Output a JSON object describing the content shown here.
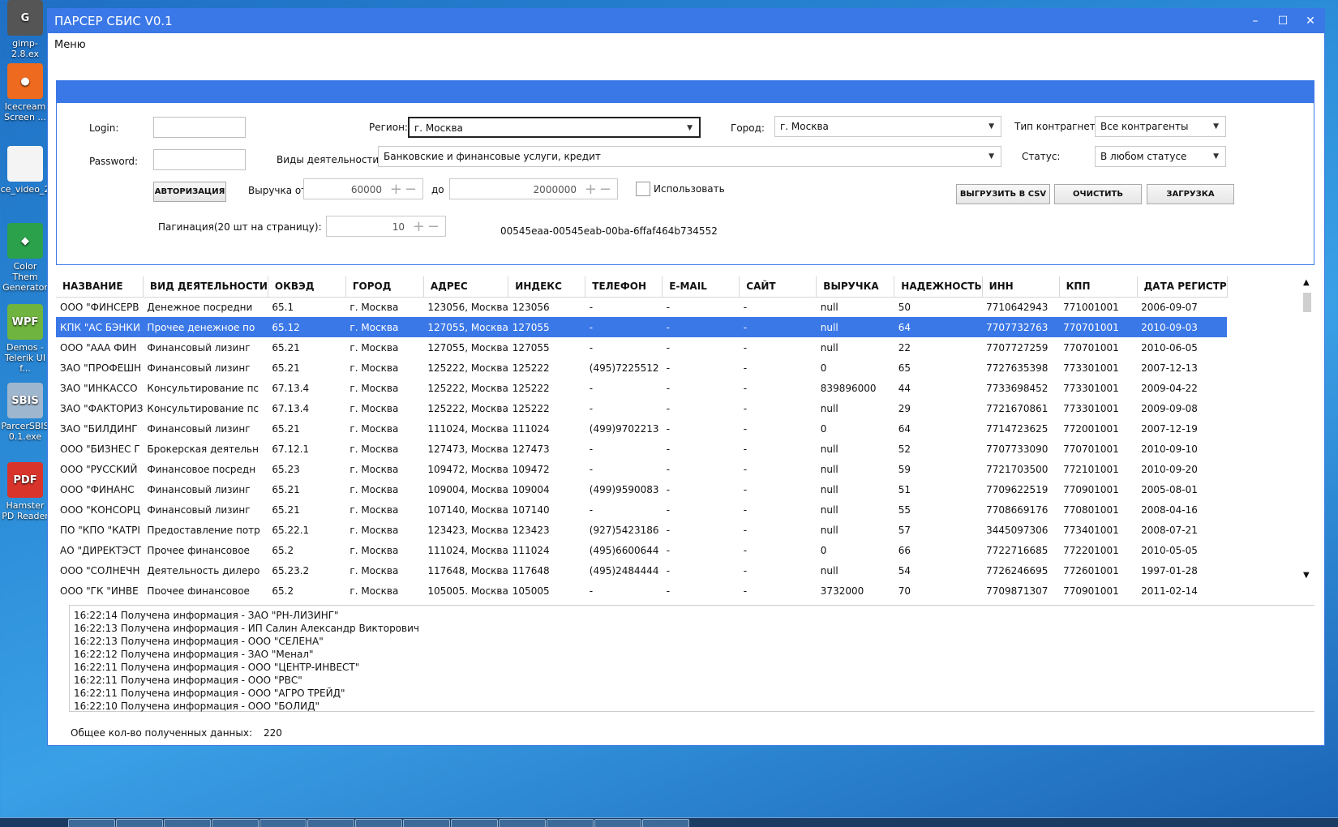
{
  "desktop_icons": [
    {
      "label": "gimp-2.8.ex",
      "color": "#555555",
      "glyph": "G"
    },
    {
      "label": "Icecream Screen ...",
      "color": "#ee6a1f",
      "glyph": "●"
    },
    {
      "label": "ce_video_2",
      "color": "#f4f4f4",
      "glyph": ""
    },
    {
      "label": "Color Them Generator",
      "color": "#2aa14a",
      "glyph": "◆"
    },
    {
      "label": "Demos - Telerik UI f...",
      "color": "#6fb43f",
      "glyph": "WPF"
    },
    {
      "label": "ParcerSBIS 0.1.exe",
      "color": "#9fb6cf",
      "glyph": "SBIS"
    },
    {
      "label": "Hamster PD Reader",
      "color": "#d9342b",
      "glyph": "PDF"
    }
  ],
  "window": {
    "title": "ПАРСЕР СБИС V0.1",
    "btn_min": "–",
    "btn_max": "☐",
    "btn_close": "✕"
  },
  "menu": {
    "label": "Меню"
  },
  "form": {
    "login_label": "Login:",
    "login_value": "",
    "password_label": "Password:",
    "password_value": "",
    "auth_button": "АВТОРИЗАЦИЯ",
    "region_label": "Регион:",
    "region_value": "г. Москва",
    "city_label": "Город:",
    "city_value": "г. Москва",
    "type_label": "Тип контрагнета:",
    "type_value": "Все контрагенты",
    "activity_label": "Виды деятельности:",
    "activity_value": "Банковские и финансовые услуги, кредит",
    "status_label": "Статус:",
    "status_value": "В любом статусе",
    "revenue_from_label": "Выручка от",
    "revenue_from_value": "60000",
    "revenue_to_label": "до",
    "revenue_to_value": "2000000",
    "use_label": "Использовать",
    "use_checked": false,
    "pagination_label": "Пагинация(20 шт на страницу):",
    "pagination_value": "10",
    "session_id": "00545eaa-00545eab-00ba-6ffaf464b734552",
    "export_button": "ВЫГРУЗИТЬ В CSV",
    "clear_button": "ОЧИСТИТЬ",
    "load_button": "ЗАГРУЗКА"
  },
  "table": {
    "columns": [
      "НАЗВАНИЕ",
      "ВИД ДЕЯТЕЛЬНОСТИ",
      "ОКВЭД",
      "ГОРОД",
      "АДРЕС",
      "ИНДЕКС",
      "ТЕЛЕФОН",
      "E-MAIL",
      "САЙТ",
      "ВЫРУЧКА",
      "НАДЕЖНОСТЬ",
      "ИНН",
      "КПП",
      "ДАТА РЕГИСТР"
    ],
    "selected_row": 1,
    "rows": [
      [
        "ООО \"ФИНСЕРВ",
        "Денежное посредни",
        "65.1",
        "г. Москва",
        "123056, Москва",
        "123056",
        "-",
        "-",
        "-",
        "null",
        "50",
        "7710642943",
        "771001001",
        "2006-09-07"
      ],
      [
        "КПК \"АС БЭНКИ",
        "Прочее денежное по",
        "65.12",
        "г. Москва",
        "127055, Москва",
        "127055",
        "-",
        "-",
        "-",
        "null",
        "64",
        "7707732763",
        "770701001",
        "2010-09-03"
      ],
      [
        "ООО \"ААА ФИН",
        "Финансовый лизинг",
        "65.21",
        "г. Москва",
        "127055, Москва",
        "127055",
        "-",
        "-",
        "-",
        "null",
        "22",
        "7707727259",
        "770701001",
        "2010-06-05"
      ],
      [
        "ЗАО \"ПРОФЕШН",
        "Финансовый лизинг",
        "65.21",
        "г. Москва",
        "125222, Москва",
        "125222",
        "(495)7225512",
        "-",
        "-",
        "0",
        "65",
        "7727635398",
        "773301001",
        "2007-12-13"
      ],
      [
        "ЗАО \"ИНКАССО",
        "Консультирование пс",
        "67.13.4",
        "г. Москва",
        "125222, Москва",
        "125222",
        "-",
        "-",
        "-",
        "839896000",
        "44",
        "7733698452",
        "773301001",
        "2009-04-22"
      ],
      [
        "ЗАО \"ФАКТОРИЗ",
        "Консультирование пс",
        "67.13.4",
        "г. Москва",
        "125222, Москва",
        "125222",
        "-",
        "-",
        "-",
        "null",
        "29",
        "7721670861",
        "773301001",
        "2009-09-08"
      ],
      [
        "ЗАО \"БИЛДИНГ",
        "Финансовый лизинг",
        "65.21",
        "г. Москва",
        "111024, Москва",
        "111024",
        "(499)9702213",
        "-",
        "-",
        "0",
        "64",
        "7714723625",
        "772001001",
        "2007-12-19"
      ],
      [
        "ООО \"БИЗНЕС Г",
        "Брокерская деятельн",
        "67.12.1",
        "г. Москва",
        "127473, Москва",
        "127473",
        "-",
        "-",
        "-",
        "null",
        "52",
        "7707733090",
        "770701001",
        "2010-09-10"
      ],
      [
        "ООО \"РУССКИЙ",
        "Финансовое посредн",
        "65.23",
        "г. Москва",
        "109472, Москва",
        "109472",
        "-",
        "-",
        "-",
        "null",
        "59",
        "7721703500",
        "772101001",
        "2010-09-20"
      ],
      [
        "ООО \"ФИНАНС",
        "Финансовый лизинг",
        "65.21",
        "г. Москва",
        "109004, Москва",
        "109004",
        "(499)9590083",
        "-",
        "-",
        "null",
        "51",
        "7709622519",
        "770901001",
        "2005-08-01"
      ],
      [
        "ООО \"КОНСОРЦ",
        "Финансовый лизинг",
        "65.21",
        "г. Москва",
        "107140, Москва",
        "107140",
        "-",
        "-",
        "-",
        "null",
        "55",
        "7708669176",
        "770801001",
        "2008-04-16"
      ],
      [
        "ПО \"КПО \"КАТРІ",
        "Предоставление потр",
        "65.22.1",
        "г. Москва",
        "123423, Москва",
        "123423",
        "(927)5423186",
        "-",
        "-",
        "null",
        "57",
        "3445097306",
        "773401001",
        "2008-07-21"
      ],
      [
        "АО \"ДИРЕКТЭСТ",
        "Прочее финансовое",
        "65.2",
        "г. Москва",
        "111024, Москва",
        "111024",
        "(495)6600644",
        "-",
        "-",
        "0",
        "66",
        "7722716685",
        "772201001",
        "2010-05-05"
      ],
      [
        "ООО \"СОЛНЕЧН",
        "Деятельность дилеро",
        "65.23.2",
        "г. Москва",
        "117648, Москва",
        "117648",
        "(495)2484444",
        "-",
        "-",
        "null",
        "54",
        "7726246695",
        "772601001",
        "1997-01-28"
      ],
      [
        "ООО \"ГК \"ИНВЕ",
        "Прочее финансовое",
        "65.2",
        "г. Москва",
        "105005, Москва",
        "105005",
        "-",
        "-",
        "-",
        "3732000",
        "70",
        "7709871307",
        "770901001",
        "2011-02-14"
      ]
    ]
  },
  "log": [
    "16:22:14 Получена информация - ЗАО \"РН-ЛИЗИНГ\"",
    "16:22:13 Получена информация - ИП Салин Александр Викторович",
    "16:22:13 Получена информация - ООО \"СЕЛЕНА\"",
    "16:22:12 Получена информация - ЗАО \"Менал\"",
    "16:22:11 Получена информация - ООО \"ЦЕНТР-ИНВЕСТ\"",
    "16:22:11 Получена информация - ООО \"РВС\"",
    "16:22:11 Получена информация - ООО \"АГРО ТРЕЙД\"",
    "16:22:10 Получена информация - ООО \"БОЛИД\""
  ],
  "footer": {
    "label": "Общее кол-во полученных данных:",
    "value": "220"
  }
}
